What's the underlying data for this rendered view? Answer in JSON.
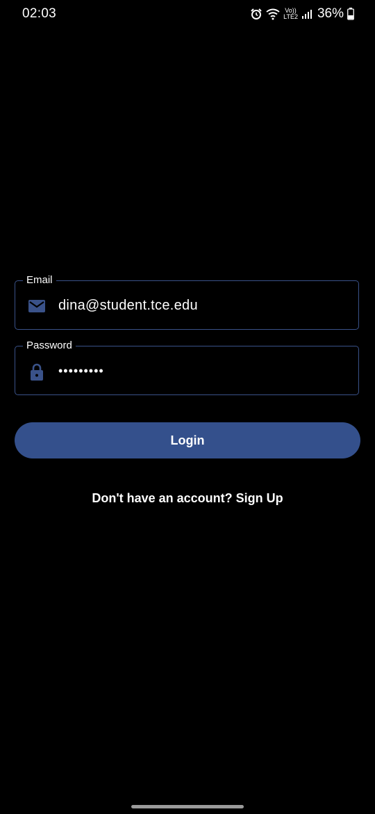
{
  "status_bar": {
    "time": "02:03",
    "network_top": "Vo))",
    "network_bottom": "LTE2",
    "battery": "36%",
    "icons": [
      "alarm-icon",
      "wifi-icon",
      "lte-icon",
      "signal-icon",
      "battery-icon"
    ]
  },
  "form": {
    "email": {
      "label": "Email",
      "value": "dina@student.tce.edu",
      "icon": "mail-icon"
    },
    "password": {
      "label": "Password",
      "value": "•••••••••",
      "icon": "lock-icon"
    }
  },
  "login_button": {
    "label": "Login"
  },
  "signup": {
    "text": "Don't have an account? Sign Up"
  },
  "colors": {
    "background": "#000000",
    "accent": "#34508c",
    "field_border": "#3a5289",
    "text": "#ffffff"
  }
}
